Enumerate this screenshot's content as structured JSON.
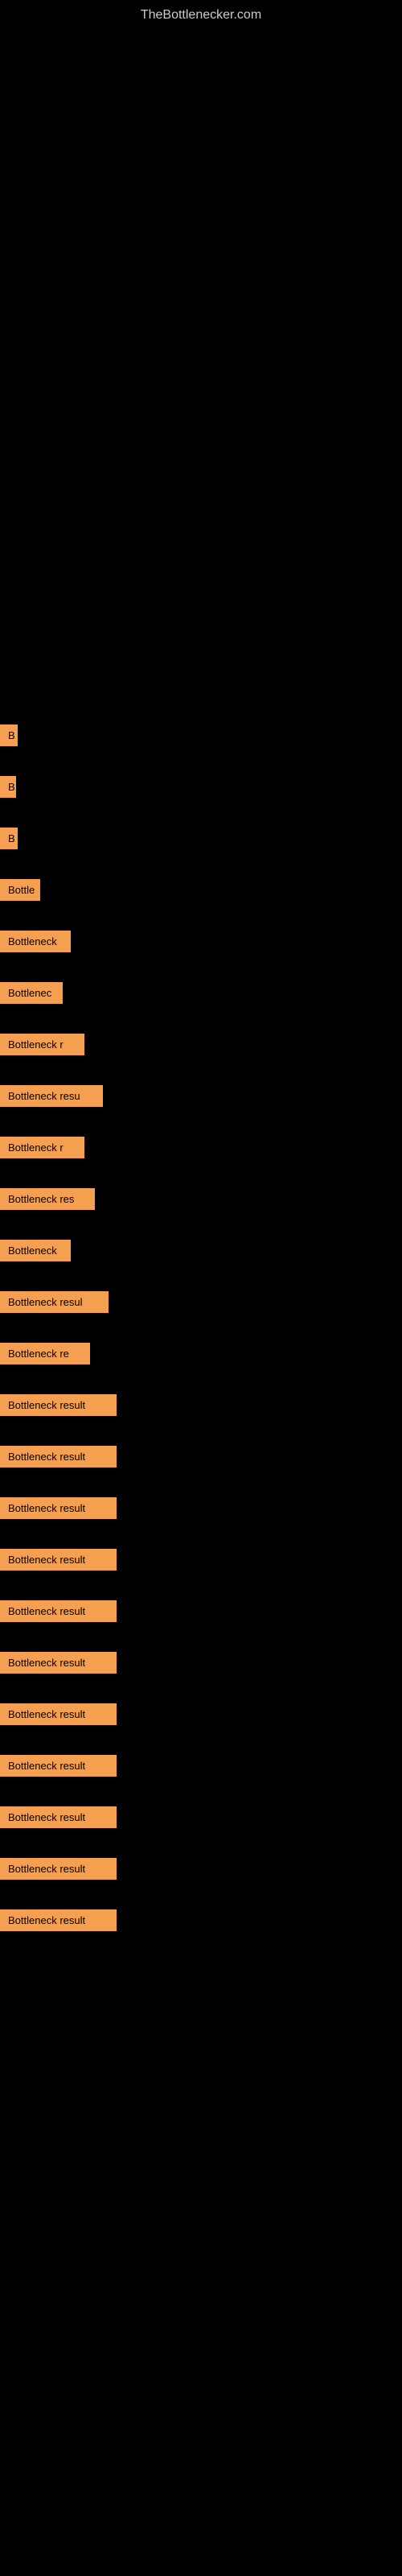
{
  "site": {
    "title": "TheBottlenecker.com"
  },
  "bottleneck_items": [
    {
      "label": "B",
      "width": 22
    },
    {
      "label": "B",
      "width": 18
    },
    {
      "label": "B",
      "width": 22
    },
    {
      "label": "Bottle",
      "width": 50
    },
    {
      "label": "Bottleneck",
      "width": 88
    },
    {
      "label": "Bottlenec",
      "width": 78
    },
    {
      "label": "Bottleneck r",
      "width": 105
    },
    {
      "label": "Bottleneck resu",
      "width": 128
    },
    {
      "label": "Bottleneck r",
      "width": 105
    },
    {
      "label": "Bottleneck res",
      "width": 118
    },
    {
      "label": "Bottleneck",
      "width": 88
    },
    {
      "label": "Bottleneck resul",
      "width": 135
    },
    {
      "label": "Bottleneck re",
      "width": 112
    },
    {
      "label": "Bottleneck result",
      "width": 145
    },
    {
      "label": "Bottleneck result",
      "width": 145
    },
    {
      "label": "Bottleneck result",
      "width": 145
    },
    {
      "label": "Bottleneck result",
      "width": 145
    },
    {
      "label": "Bottleneck result",
      "width": 145
    },
    {
      "label": "Bottleneck result",
      "width": 145
    },
    {
      "label": "Bottleneck result",
      "width": 145
    },
    {
      "label": "Bottleneck result",
      "width": 145
    },
    {
      "label": "Bottleneck result",
      "width": 145
    },
    {
      "label": "Bottleneck result",
      "width": 145
    },
    {
      "label": "Bottleneck result",
      "width": 145
    }
  ]
}
